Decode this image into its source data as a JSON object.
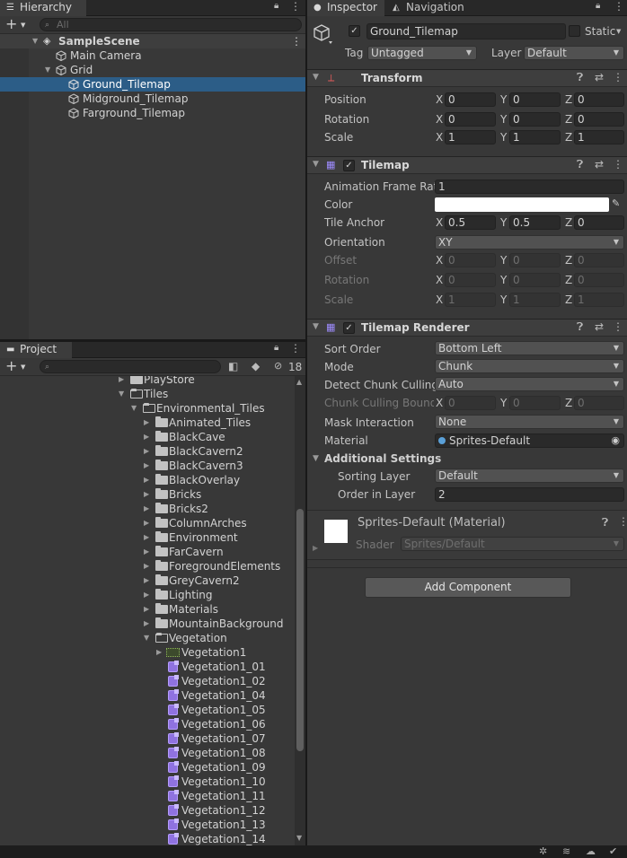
{
  "hierarchy": {
    "tab_label": "Hierarchy",
    "search_placeholder": "All",
    "rows": [
      "SampleScene",
      "Main Camera",
      "Grid",
      "Ground_Tilemap",
      "Midground_Tilemap",
      "Farground_Tilemap"
    ]
  },
  "project": {
    "tab_label": "Project",
    "hidden_count": "18",
    "items": [
      "PlayStore",
      "Tiles",
      "Environmental_Tiles",
      "Animated_Tiles",
      "BlackCave",
      "BlackCavern2",
      "BlackCavern3",
      "BlackOverlay",
      "Bricks",
      "Bricks2",
      "ColumnArches",
      "Environment",
      "FarCavern",
      "ForegroundElements",
      "GreyCavern2",
      "Lighting",
      "Materials",
      "MountainBackground",
      "Vegetation",
      "Vegetation1",
      "Vegetation1_01",
      "Vegetation1_02",
      "Vegetation1_04",
      "Vegetation1_05",
      "Vegetation1_06",
      "Vegetation1_07",
      "Vegetation1_08",
      "Vegetation1_09",
      "Vegetation1_10",
      "Vegetation1_11",
      "Vegetation1_12",
      "Vegetation1_13",
      "Vegetation1_14"
    ]
  },
  "inspector": {
    "tab_label": "Inspector",
    "nav_tab_label": "Navigation",
    "object_name": "Ground_Tilemap",
    "static_label": "Static",
    "tag_label": "Tag",
    "tag_value": "Untagged",
    "layer_label": "Layer",
    "layer_value": "Default",
    "transform": {
      "title": "Transform",
      "position_label": "Position",
      "position": [
        "0",
        "0",
        "0"
      ],
      "rotation_label": "Rotation",
      "rotation": [
        "0",
        "0",
        "0"
      ],
      "scale_label": "Scale",
      "scale": [
        "1",
        "1",
        "1"
      ]
    },
    "tilemap": {
      "title": "Tilemap",
      "anim_label": "Animation Frame Rate",
      "anim_value": "1",
      "color_label": "Color",
      "color_value": "#ffffff",
      "anchor_label": "Tile Anchor",
      "anchor": [
        "0.5",
        "0.5",
        "0"
      ],
      "orientation_label": "Orientation",
      "orientation_value": "XY",
      "offset_label": "Offset",
      "offset": [
        "0",
        "0",
        "0"
      ],
      "rotation_label": "Rotation",
      "rotation": [
        "0",
        "0",
        "0"
      ],
      "scale_label": "Scale",
      "scale": [
        "1",
        "1",
        "1"
      ]
    },
    "renderer": {
      "title": "Tilemap Renderer",
      "sort_order_label": "Sort Order",
      "sort_order_value": "Bottom Left",
      "mode_label": "Mode",
      "mode_value": "Chunk",
      "detect_label": "Detect Chunk Culling",
      "detect_value": "Auto",
      "bounds_label": "Chunk Culling Bounds",
      "bounds": [
        "0",
        "0",
        "0"
      ],
      "mask_label": "Mask Interaction",
      "mask_value": "None",
      "material_label": "Material",
      "material_value": "Sprites-Default",
      "additional_label": "Additional Settings",
      "sorting_layer_label": "Sorting Layer",
      "sorting_layer_value": "Default",
      "order_label": "Order in Layer",
      "order_value": "2"
    },
    "material": {
      "title": "Sprites-Default (Material)",
      "shader_label": "Shader",
      "shader_value": "Sprites/Default"
    },
    "add_component_label": "Add Component"
  },
  "axes": {
    "x": "X",
    "y": "Y",
    "z": "Z"
  },
  "colors": {
    "selection": "#2c5d87",
    "panel": "#383838",
    "sprite": "#8f72e0"
  }
}
